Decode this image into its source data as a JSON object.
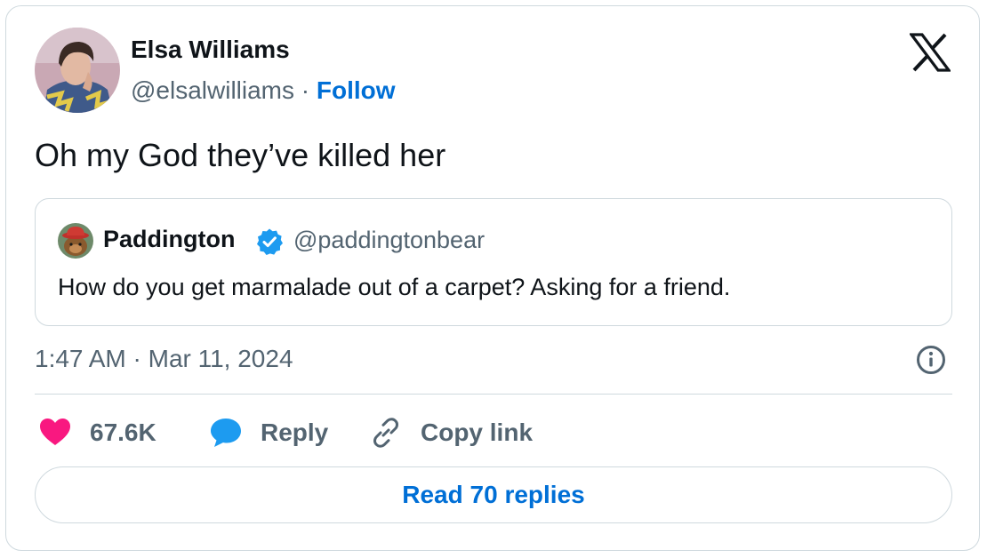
{
  "author": {
    "name": "Elsa Williams",
    "handle": "@elsalwilliams",
    "separator": "·",
    "follow_label": "Follow",
    "avatar_icon": "profile-photo"
  },
  "brand_logo": "x-logo-icon",
  "tweet": {
    "text": "Oh my God they’ve killed her"
  },
  "quoted_tweet": {
    "name": "Paddington",
    "verified": true,
    "handle": "@paddingtonbear",
    "text": "How do you get marmalade out of a carpet? Asking for a friend.",
    "avatar_icon": "paddington-bear-avatar"
  },
  "timestamp": "1:47 AM · Mar 11, 2024",
  "actions": {
    "like_count": "67.6K",
    "reply_label": "Reply",
    "copy_link_label": "Copy link"
  },
  "read_replies_label": "Read 70 replies",
  "colors": {
    "accent": "#006fd6",
    "like": "#f91880",
    "verified": "#1d9bf0",
    "secondary_text": "#536471",
    "border": "#cfd9de"
  }
}
